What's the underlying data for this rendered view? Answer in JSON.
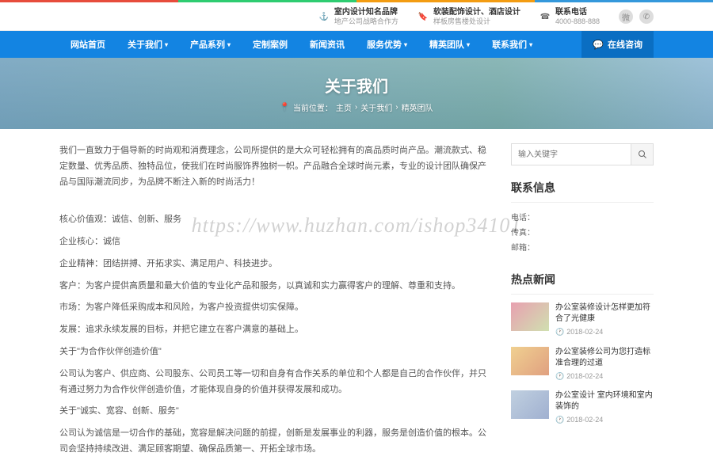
{
  "top": {
    "items": [
      {
        "t1": "室内设计知名品牌",
        "t2": "地产公司战略合作方"
      },
      {
        "t1": "软装配饰设计、酒店设计",
        "t2": "样板房售楼处设计"
      },
      {
        "t1": "联系电话",
        "t2": "4000-888-888"
      }
    ]
  },
  "nav": {
    "items": [
      "网站首页",
      "关于我们",
      "产品系列",
      "定制案例",
      "新闻资讯",
      "服务优势",
      "精英团队",
      "联系我们"
    ],
    "chat": "在线咨询"
  },
  "banner": {
    "title": "关于我们",
    "crumb_label": "当前位置：",
    "crumb": [
      "主页",
      "关于我们",
      "精英团队"
    ]
  },
  "content": {
    "p1": "我们一直致力于倡导新的时尚观和消费理念，公司所提供的是大众可轻松拥有的高品质时尚产品。潮流款式、稳定数量、优秀品质、独特品位，使我们在时尚服饰界独树一帜。产品融合全球时尚元素，专业的设计团队确保产品与国际潮流同步，为品牌不断注入新的时尚活力！",
    "p2": "核心价值观：诚信、创新、服务",
    "p3": "企业核心：诚信",
    "p4": "企业精神：团结拼搏、开拓求实、满足用户、科技进步。",
    "p5": "客户：为客户提供高质量和最大价值的专业化产品和服务，以真诚和实力赢得客户的理解、尊重和支持。",
    "p6": "市场：为客户降低采购成本和风险，为客户投资提供切实保障。",
    "p7": "发展：追求永续发展的目标，并把它建立在客户满意的基础上。",
    "p8": "关于\"为合作伙伴创造价值\"",
    "p9": "公司认为客户、供应商、公司股东、公司员工等一切和自身有合作关系的单位和个人都是自己的合作伙伴，并只有通过努力为合作伙伴创造价值，才能体现自身的价值并获得发展和成功。",
    "p10": "关于\"诚实、宽容、创新、服务\"",
    "p11": "公司认为诚信是一切合作的基础，宽容是解决问题的前提，创新是发展事业的利器，服务是创造价值的根本。公司会坚持持续改进、满足顾客期望、确保品质第一、开拓全球市场。"
  },
  "search": {
    "placeholder": "输入关键字"
  },
  "sidebar": {
    "contact_title": "联系信息",
    "contact": [
      {
        "k": "电话：",
        "v": ""
      },
      {
        "k": "传真：",
        "v": ""
      },
      {
        "k": "邮箱：",
        "v": ""
      }
    ],
    "news_title": "热点新闻",
    "news": [
      {
        "title": "办公室装修设计怎样更加符合了光健康",
        "date": "2018-02-24"
      },
      {
        "title": "办公室装修公司为您打造标准合理的过道",
        "date": "2018-02-24"
      },
      {
        "title": "办公室设计 室内环境和室内装饰的",
        "date": "2018-02-24"
      }
    ]
  },
  "watermark": "https://www.huzhan.com/ishop34101"
}
